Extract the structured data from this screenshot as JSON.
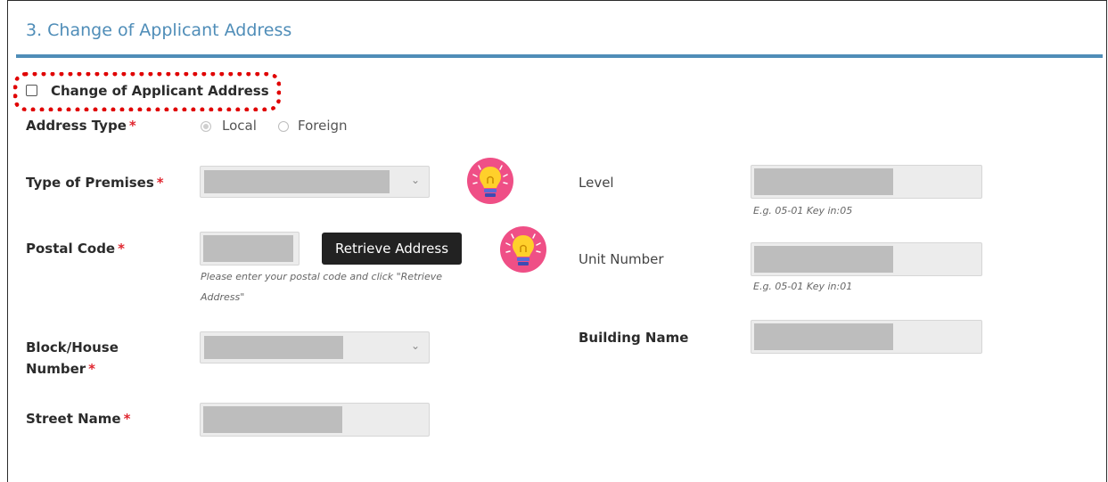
{
  "section": {
    "title": "3. Change of Applicant Address",
    "checkbox_label": "Change of Applicant Address"
  },
  "colors": {
    "accent": "#4f8db8",
    "required": "#e0262f",
    "highlight": "#e00000",
    "button_bg": "#222222"
  },
  "address_type": {
    "label": "Address Type",
    "required_mark": "*",
    "options": [
      "Local",
      "Foreign"
    ],
    "selected": "Local"
  },
  "fields": {
    "type_of_premises": {
      "label": "Type of Premises",
      "required_mark": "*"
    },
    "postal_code": {
      "label": "Postal Code",
      "required_mark": "*",
      "hint_line1": "Please enter your postal code and click \"Retrieve",
      "hint_line2": "Address\""
    },
    "block_house_number": {
      "label_line1": "Block/House",
      "label_line2": "Number",
      "required_mark": "*"
    },
    "street_name": {
      "label": "Street Name",
      "required_mark": "*"
    },
    "level": {
      "label": "Level",
      "hint": "E.g. 05-01 Key in:05"
    },
    "unit_number": {
      "label": "Unit Number",
      "hint": "E.g. 05-01 Key in:01"
    },
    "building_name": {
      "label": "Building Name"
    }
  },
  "buttons": {
    "retrieve_address": "Retrieve Address"
  },
  "icons": {
    "tip": "lightbulb-icon",
    "dropdown": "chevron-down-icon"
  }
}
